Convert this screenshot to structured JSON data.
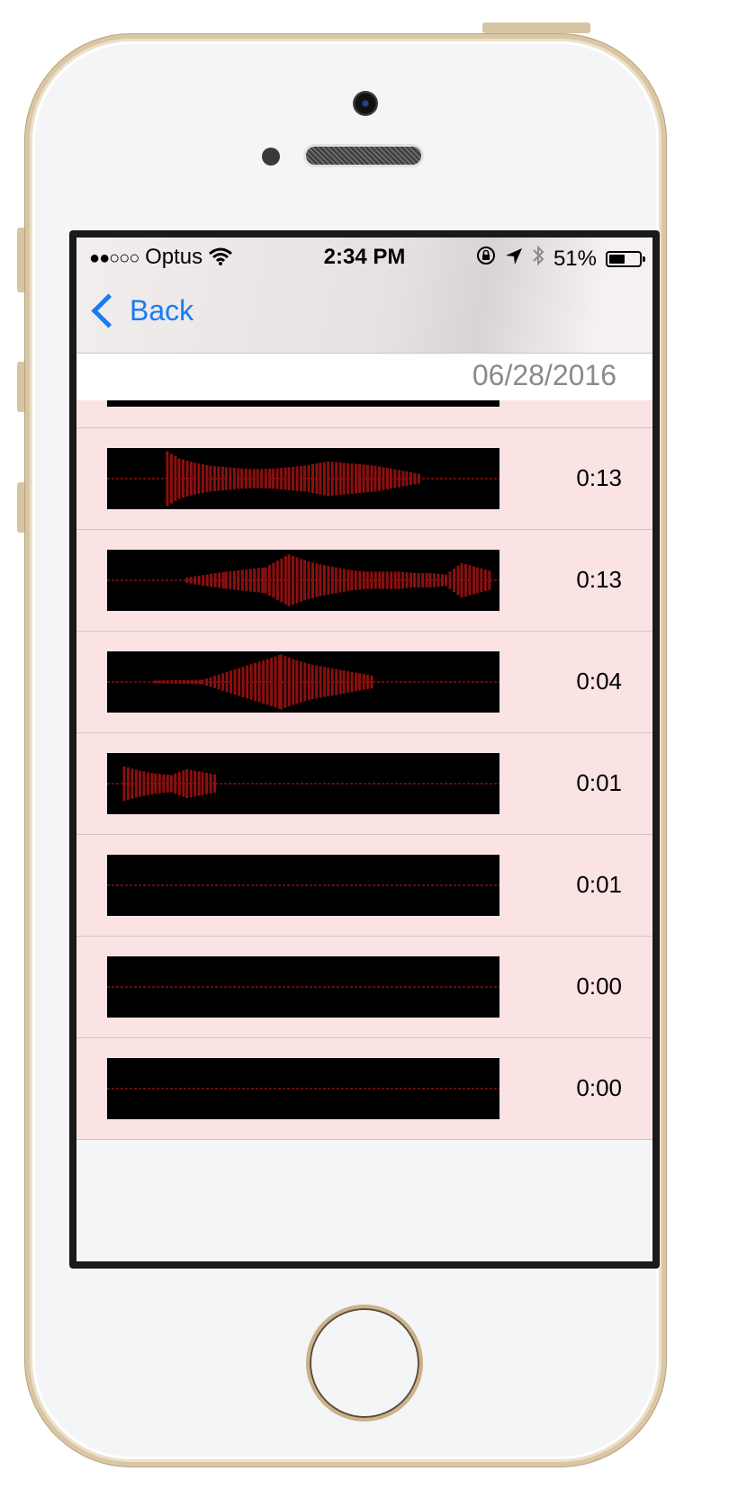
{
  "status_bar": {
    "signal_dots": "●●○○○",
    "carrier": "Optus",
    "time": "2:34 PM",
    "battery": "51%"
  },
  "nav": {
    "back_label": "Back"
  },
  "section": {
    "date": "06/28/2016"
  },
  "recordings": [
    {
      "duration": "0:13"
    },
    {
      "duration": "0:13"
    },
    {
      "duration": "0:04"
    },
    {
      "duration": "0:01"
    },
    {
      "duration": "0:01"
    },
    {
      "duration": "0:00"
    },
    {
      "duration": "0:00"
    }
  ],
  "colors": {
    "accent": "#1a7cf1",
    "row_background": "#fbe3e3",
    "waveform": "#8b0f0f"
  },
  "icons": [
    "wifi-icon",
    "orientation-lock-icon",
    "location-icon",
    "bluetooth-icon",
    "battery-icon",
    "chevron-left-icon"
  ]
}
